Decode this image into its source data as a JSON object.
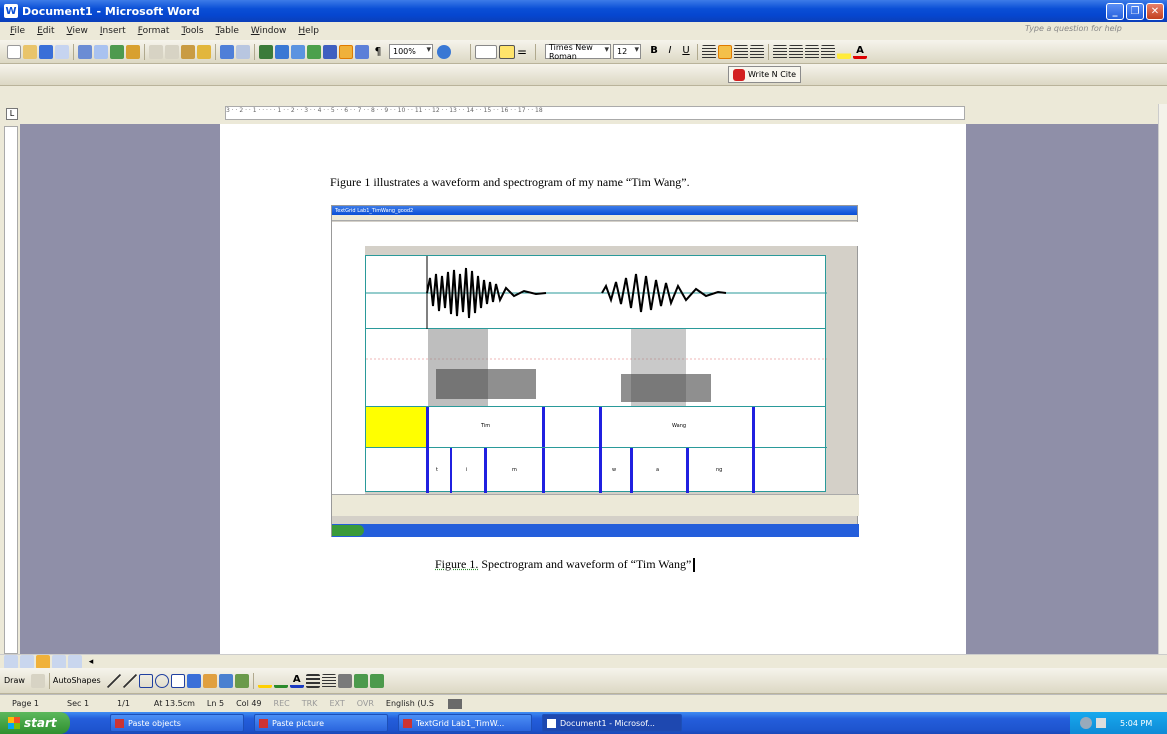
{
  "window": {
    "title": "Document1 - Microsoft Word",
    "help_placeholder": "Type a question for help"
  },
  "menu": [
    "File",
    "Edit",
    "View",
    "Insert",
    "Format",
    "Tools",
    "Table",
    "Window",
    "Help"
  ],
  "toolbar": {
    "zoom": "100%",
    "style": "",
    "font": "Times New Roman",
    "size": "12"
  },
  "writenCite": {
    "label": "Write N Cite"
  },
  "ruler": {
    "marks": "3 · · 2 · · 1 · · ·  · · 1 · · 2 · · 3 · · 4 · · 5 · · 6 · · 7 · · 8 · · 9 · · 10 · · 11 · · 12 · · 13 · · 14 · · 15 · · 16 · · 17 · · 18"
  },
  "document": {
    "paragraph": "Figure 1 illustrates a waveform and spectrogram of my name “Tim Wang”.",
    "caption_label": "Figure 1.",
    "caption_text": " Spectrogram and waveform of “Tim Wang”"
  },
  "embedded_figure": {
    "window_title": "TextGrid Lab1_TimWang_good2",
    "tier1_labels": [
      "Tim",
      "Wang"
    ],
    "tier2_labels": [
      "t",
      "i",
      "m",
      "w",
      "a",
      "ng"
    ]
  },
  "drawing": {
    "draw": "Draw",
    "autoshapes": "AutoShapes"
  },
  "status": {
    "page": "Page 1",
    "sec": "Sec 1",
    "pages": "1/1",
    "at": "At 13.5cm",
    "ln": "Ln 5",
    "col": "Col 49",
    "rec": "REC",
    "trk": "TRK",
    "ext": "EXT",
    "ovr": "OVR",
    "lang": "English (U.S"
  },
  "taskbar": {
    "start": "start",
    "tasks": [
      "Paste objects",
      "Paste picture",
      "TextGrid Lab1_TimW...",
      "Document1 - Microsof..."
    ],
    "time": "5:04 PM"
  },
  "colors": {
    "accent": "#0a4fd6",
    "page_bg": "#8f8fa8"
  }
}
